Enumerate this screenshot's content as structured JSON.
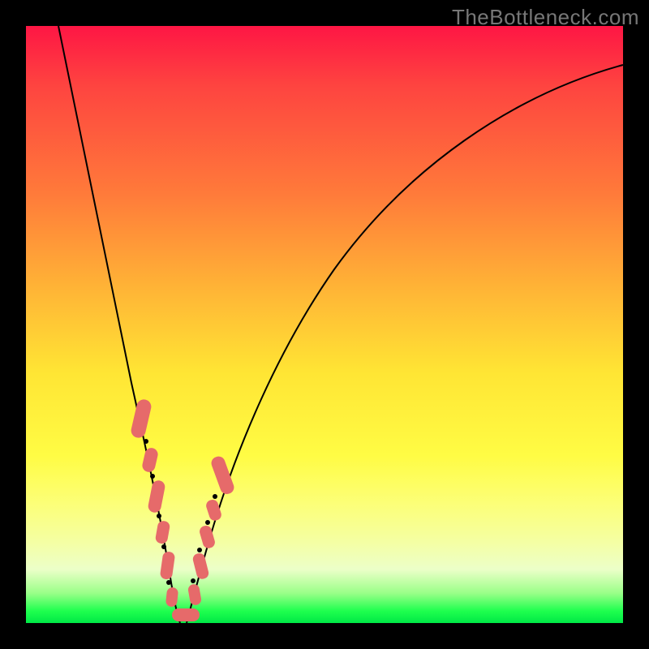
{
  "watermark": "TheBottleneck.com",
  "colors": {
    "frame": "#000000",
    "gradient_top": "#fe1644",
    "gradient_bottom": "#00e846",
    "curve": "#000000",
    "bead": "#e66a6a"
  },
  "chart_data": {
    "type": "line",
    "title": "",
    "xlabel": "",
    "ylabel": "",
    "xlim": [
      0,
      100
    ],
    "ylim": [
      0,
      100
    ],
    "note": "Bottleneck-style V-curve. Y≈100 means high bottleneck (red), Y≈0 means none (green). Minimum near x≈24.",
    "series": [
      {
        "name": "bottleneck-curve",
        "x": [
          4,
          6,
          8,
          10,
          12,
          14,
          16,
          18,
          20,
          22,
          24,
          26,
          28,
          30,
          32,
          36,
          40,
          46,
          54,
          64,
          76,
          90,
          100
        ],
        "y": [
          100,
          92,
          84,
          75,
          66,
          57,
          47,
          37,
          26,
          14,
          2,
          2,
          14,
          24,
          32,
          44,
          54,
          64,
          74,
          82,
          88,
          92,
          94
        ]
      }
    ],
    "markers": {
      "name": "highlighted-range-beads",
      "points": [
        {
          "x": 17.5,
          "y": 40
        },
        {
          "x": 18.5,
          "y": 33
        },
        {
          "x": 20.0,
          "y": 25
        },
        {
          "x": 21.0,
          "y": 18
        },
        {
          "x": 22.0,
          "y": 12
        },
        {
          "x": 23.0,
          "y": 6
        },
        {
          "x": 24.5,
          "y": 2
        },
        {
          "x": 26.0,
          "y": 4
        },
        {
          "x": 27.5,
          "y": 12
        },
        {
          "x": 29.0,
          "y": 20
        },
        {
          "x": 30.0,
          "y": 26
        },
        {
          "x": 31.5,
          "y": 32
        }
      ]
    }
  }
}
